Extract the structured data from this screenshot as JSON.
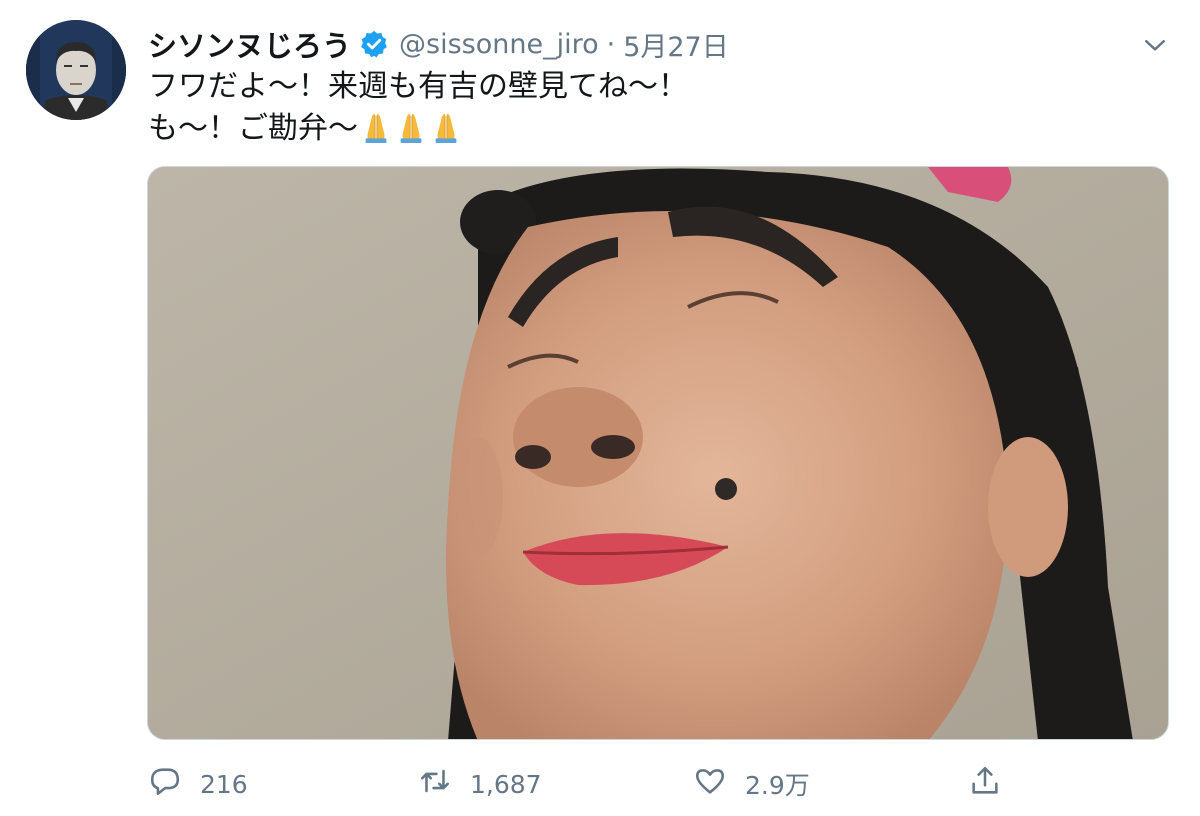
{
  "tweet": {
    "display_name": "シソンヌじろう",
    "handle": "@sissonne_jiro",
    "separator": "·",
    "date": "5月27日",
    "text_line1": "フワだよ〜！来週も有吉の壁見てね〜！",
    "text_line2": "も〜！ご勘弁〜",
    "emoji": [
      "folded-hands",
      "folded-hands",
      "folded-hands"
    ]
  },
  "actions": {
    "reply_count": "216",
    "retweet_count": "1,687",
    "like_count": "2.9万"
  },
  "icons": {
    "verified": "verified-badge-icon",
    "caret": "chevron-down-icon",
    "reply": "reply-icon",
    "retweet": "retweet-icon",
    "like": "heart-icon",
    "share": "share-icon"
  },
  "colors": {
    "text": "#14171a",
    "secondary": "#657786",
    "verified": "#1da1f2",
    "border": "#ccd6dd"
  }
}
